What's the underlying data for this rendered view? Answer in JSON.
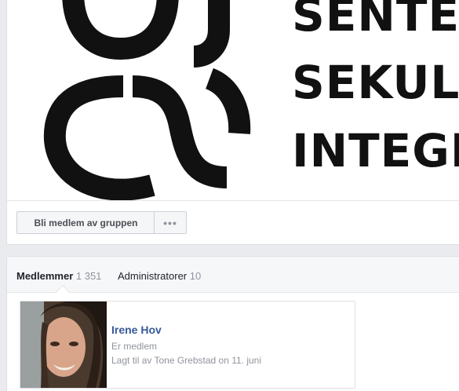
{
  "cover": {
    "logo_lines": [
      "SENTER",
      "SEKULÆR",
      "INTEGR"
    ],
    "logo_icon": "ss-swirl-logo-icon"
  },
  "actions": {
    "join_label": "Bli medlem av gruppen",
    "more_label": "•••"
  },
  "members_tabs": {
    "members_label": "Medlemmer",
    "members_count": "1 351",
    "admins_label": "Administratorer",
    "admins_count": "10"
  },
  "member": {
    "name": "Irene Hov",
    "role": "Er medlem",
    "added": "Lagt til av Tone Grebstad on 11. juni"
  }
}
